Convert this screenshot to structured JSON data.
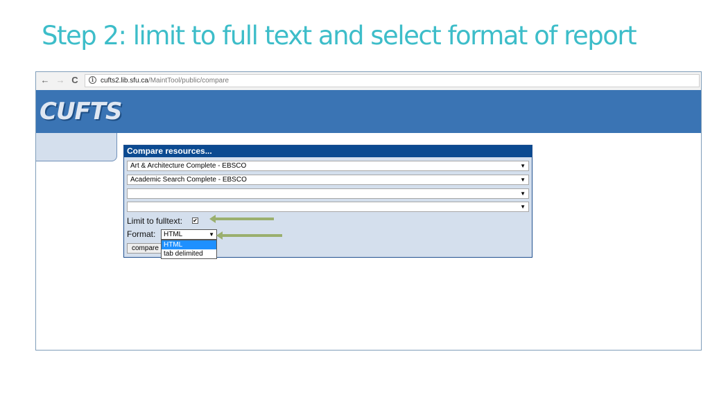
{
  "slide": {
    "title": "Step 2: limit to full text and select format of report"
  },
  "browser": {
    "back_icon": "←",
    "forward_icon": "→",
    "reload_icon": "C",
    "info_icon": "i",
    "url_host": "cufts2.lib.sfu.ca",
    "url_path": "/MaintTool/public/compare"
  },
  "app": {
    "logo": "CUFTS"
  },
  "compare": {
    "title": "Compare resources...",
    "resources": [
      "Art & Architecture Complete - EBSCO",
      "Academic Search Complete - EBSCO",
      "",
      ""
    ],
    "dropdown_arrow": "▼",
    "limit_label": "Limit to fulltext:",
    "limit_checked": true,
    "check_mark": "✔",
    "format_label": "Format:",
    "format_value": "HTML",
    "format_options": [
      "HTML",
      "tab delimited"
    ],
    "compare_button": "compare"
  },
  "annotation_colors": {
    "arrow": "#9aaf6e",
    "title": "#3dbdc9"
  }
}
